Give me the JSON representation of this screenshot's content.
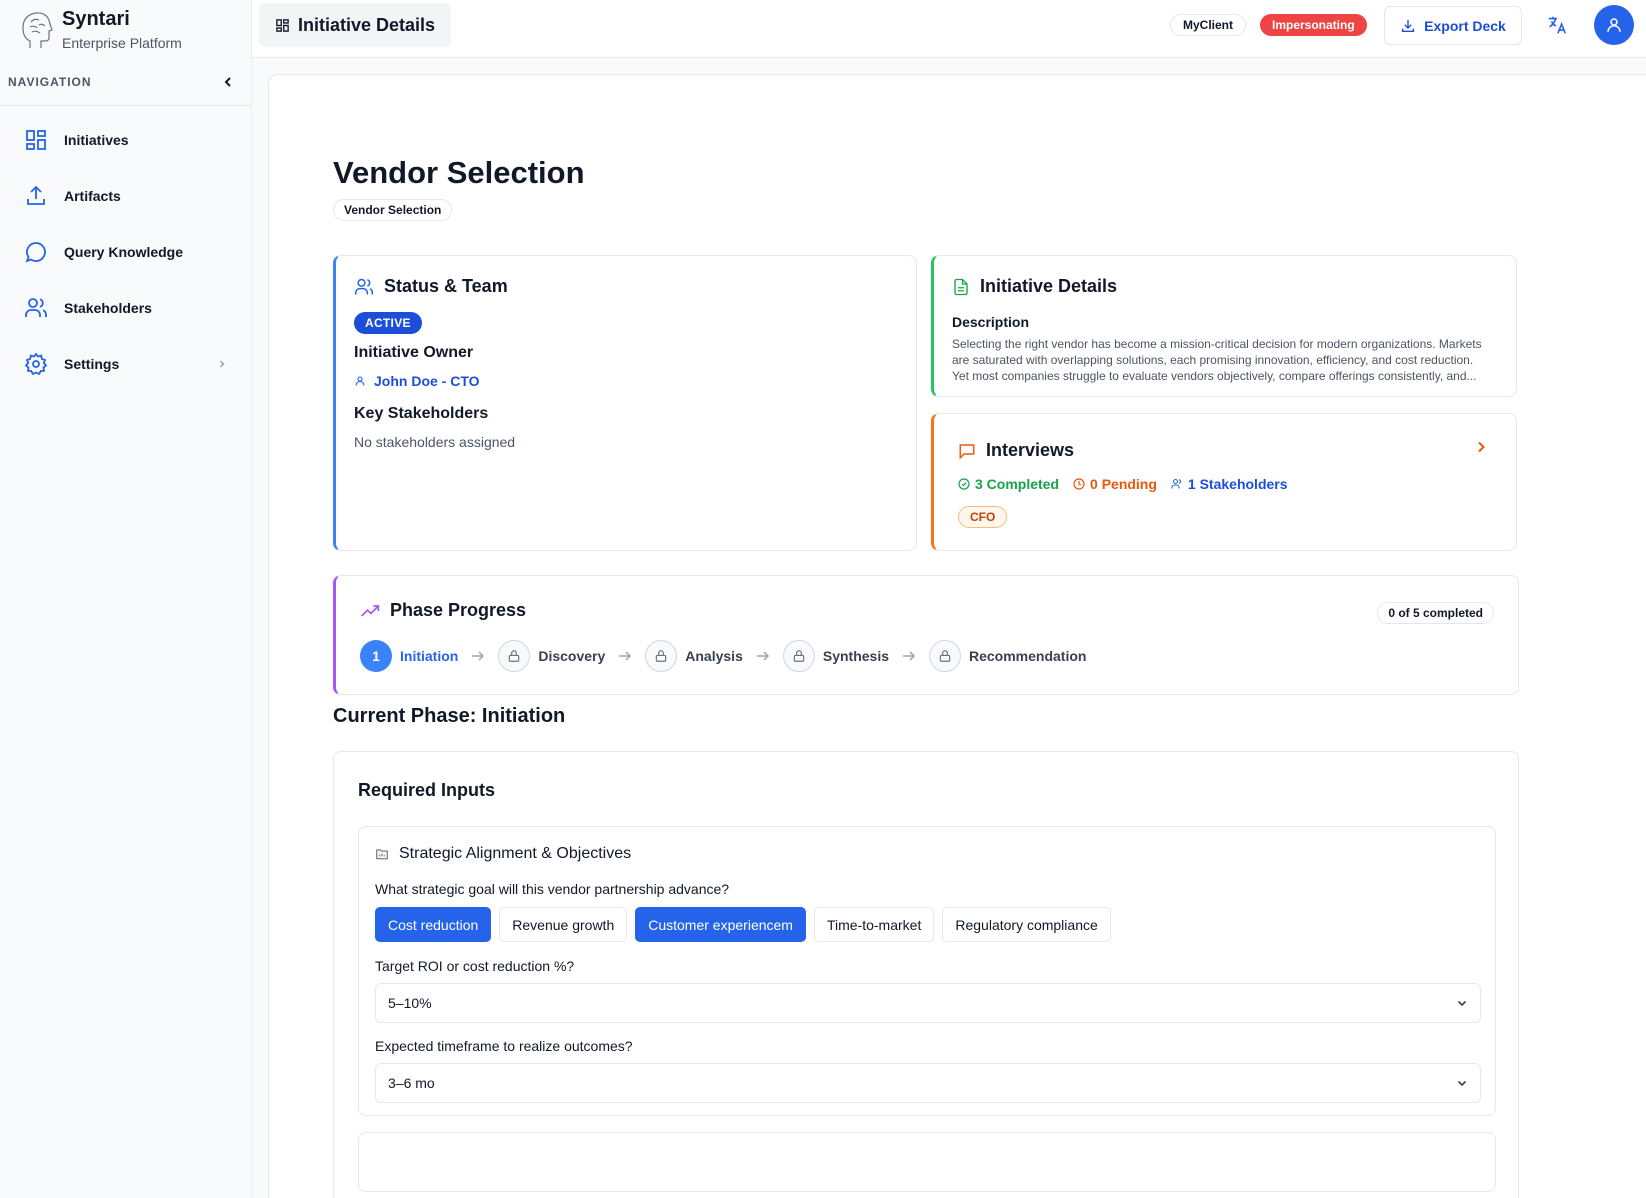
{
  "brand": {
    "name": "Syntari",
    "subtitle": "Enterprise Platform",
    "logo_icon": "brain-head-icon"
  },
  "sidebar": {
    "header_label": "NAVIGATION",
    "items": [
      {
        "label": "Initiatives",
        "icon": "grid-icon"
      },
      {
        "label": "Artifacts",
        "icon": "upload-icon"
      },
      {
        "label": "Query Knowledge",
        "icon": "chat-bubble-icon"
      },
      {
        "label": "Stakeholders",
        "icon": "users-icon"
      },
      {
        "label": "Settings",
        "icon": "gear-icon"
      }
    ]
  },
  "topbar": {
    "breadcrumb": "Initiative Details",
    "client_chip": "MyClient",
    "impersonating_chip": "Impersonating",
    "export_label": "Export Deck"
  },
  "page": {
    "title": "Vendor Selection",
    "tag": "Vendor Selection"
  },
  "status_card": {
    "title": "Status & Team",
    "status": "ACTIVE",
    "owner_heading": "Initiative Owner",
    "owner_name": "John Doe - CTO",
    "stakeholders_heading": "Key Stakeholders",
    "stakeholders_empty": "No stakeholders assigned"
  },
  "details_card": {
    "title": "Initiative Details",
    "description_label": "Description",
    "description_lines": [
      "Selecting the right vendor has become a mission-critical decision for modern organizations. Markets",
      "are saturated with overlapping solutions, each promising innovation, efficiency, and cost reduction.",
      "Yet most companies struggle to evaluate vendors objectively, compare offerings consistently, and..."
    ]
  },
  "interviews_card": {
    "title": "Interviews",
    "completed": "3 Completed",
    "pending": "0 Pending",
    "stakeholders": "1 Stakeholders",
    "role_chip": "CFO"
  },
  "phase_progress": {
    "title": "Phase Progress",
    "count": "0 of 5 completed",
    "steps": [
      {
        "label": "Initiation",
        "number": "1",
        "state": "current"
      },
      {
        "label": "Discovery",
        "state": "locked"
      },
      {
        "label": "Analysis",
        "state": "locked"
      },
      {
        "label": "Synthesis",
        "state": "locked"
      },
      {
        "label": "Recommendation",
        "state": "locked"
      }
    ]
  },
  "current_phase": "Current Phase: Initiation",
  "required_inputs": {
    "title": "Required Inputs",
    "section_title": "Strategic Alignment & Objectives",
    "q1": "What strategic goal will this vendor partnership advance?",
    "options": [
      {
        "label": "Cost reduction",
        "selected": true
      },
      {
        "label": "Revenue growth",
        "selected": false
      },
      {
        "label": "Customer experiencem",
        "selected": true
      },
      {
        "label": "Time-to-market",
        "selected": false
      },
      {
        "label": "Regulatory compliance",
        "selected": false
      }
    ],
    "q2": "Target ROI or cost reduction %?",
    "q2_value": "5–10%",
    "q3": "Expected timeframe to realize outcomes?",
    "q3_value": "3–6 mo"
  },
  "colors": {
    "primary": "#2563eb",
    "danger": "#ef4444",
    "success": "#16a34a",
    "warning": "#ea580c",
    "purple": "#a855f7"
  }
}
